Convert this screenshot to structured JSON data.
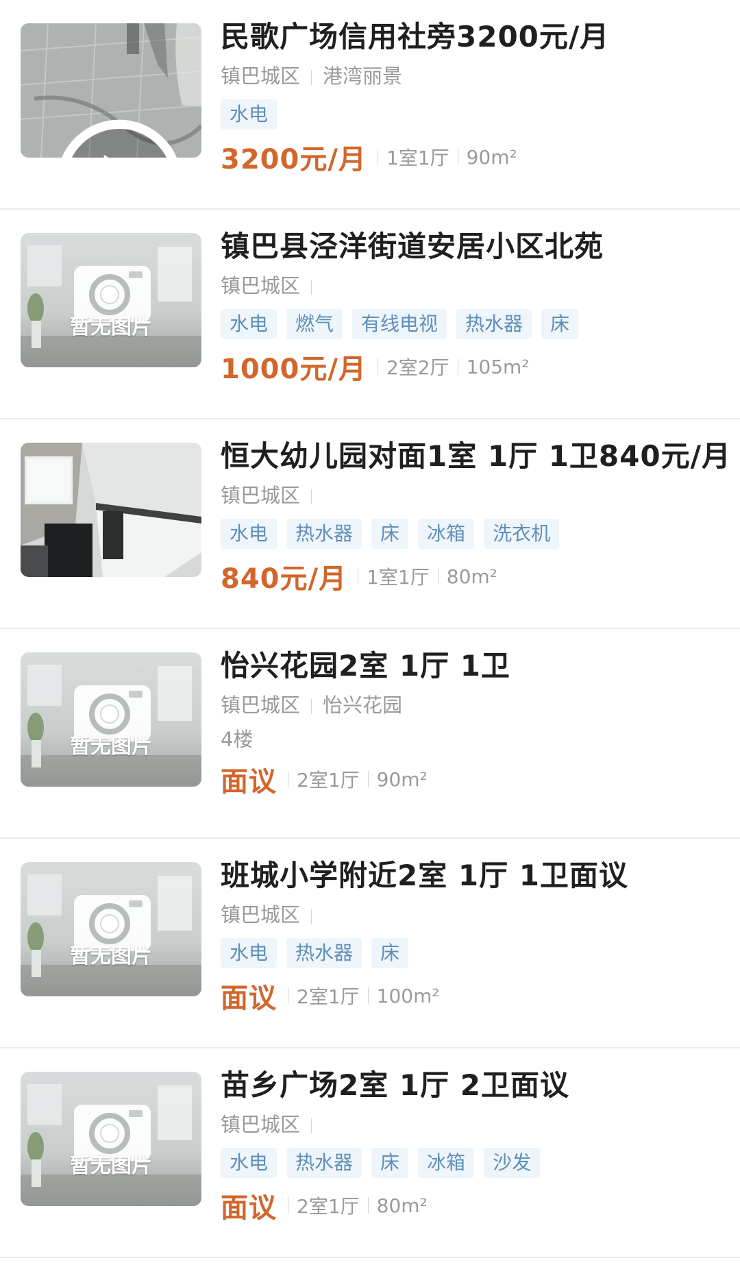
{
  "listings": [
    {
      "title": "民歌广场信用社旁3200元/月",
      "area": "镇巴城区",
      "community": "港湾丽景",
      "extra": "",
      "tags": [
        "水电"
      ],
      "price": "3200元/月",
      "rooms": "1室1厅",
      "size": "90m²",
      "thumb": "video-photo"
    },
    {
      "title": "镇巴县泾洋街道安居小区北苑",
      "area": "镇巴城区",
      "community": "",
      "extra": "",
      "tags": [
        "水电",
        "燃气",
        "有线电视",
        "热水器",
        "床"
      ],
      "price": "1000元/月",
      "rooms": "2室2厅",
      "size": "105m²",
      "thumb": "no-image"
    },
    {
      "title": "恒大幼儿园对面1室 1厅 1卫840元/月",
      "area": "镇巴城区",
      "community": "",
      "extra": "",
      "tags": [
        "水电",
        "热水器",
        "床",
        "冰箱",
        "洗衣机"
      ],
      "price": "840元/月",
      "rooms": "1室1厅",
      "size": "80m²",
      "thumb": "room-photo"
    },
    {
      "title": "怡兴花园2室 1厅 1卫",
      "area": "镇巴城区",
      "community": "怡兴花园",
      "extra": "4楼",
      "tags": [],
      "price": "面议",
      "rooms": "2室1厅",
      "size": "90m²",
      "thumb": "no-image"
    },
    {
      "title": "班城小学附近2室 1厅 1卫面议",
      "area": "镇巴城区",
      "community": "",
      "extra": "",
      "tags": [
        "水电",
        "热水器",
        "床"
      ],
      "price": "面议",
      "rooms": "2室1厅",
      "size": "100m²",
      "thumb": "no-image"
    },
    {
      "title": "苗乡广场2室 1厅 2卫面议",
      "area": "镇巴城区",
      "community": "",
      "extra": "",
      "tags": [
        "水电",
        "热水器",
        "床",
        "冰箱",
        "沙发"
      ],
      "price": "面议",
      "rooms": "2室1厅",
      "size": "80m²",
      "thumb": "no-image"
    }
  ],
  "no_image_text": "暂无图片",
  "colors": {
    "price": "#d2662b",
    "tag_bg": "#eef5fb",
    "tag_text": "#5f8fb8",
    "meta": "#9a9a9a",
    "title": "#1f1f1f"
  }
}
